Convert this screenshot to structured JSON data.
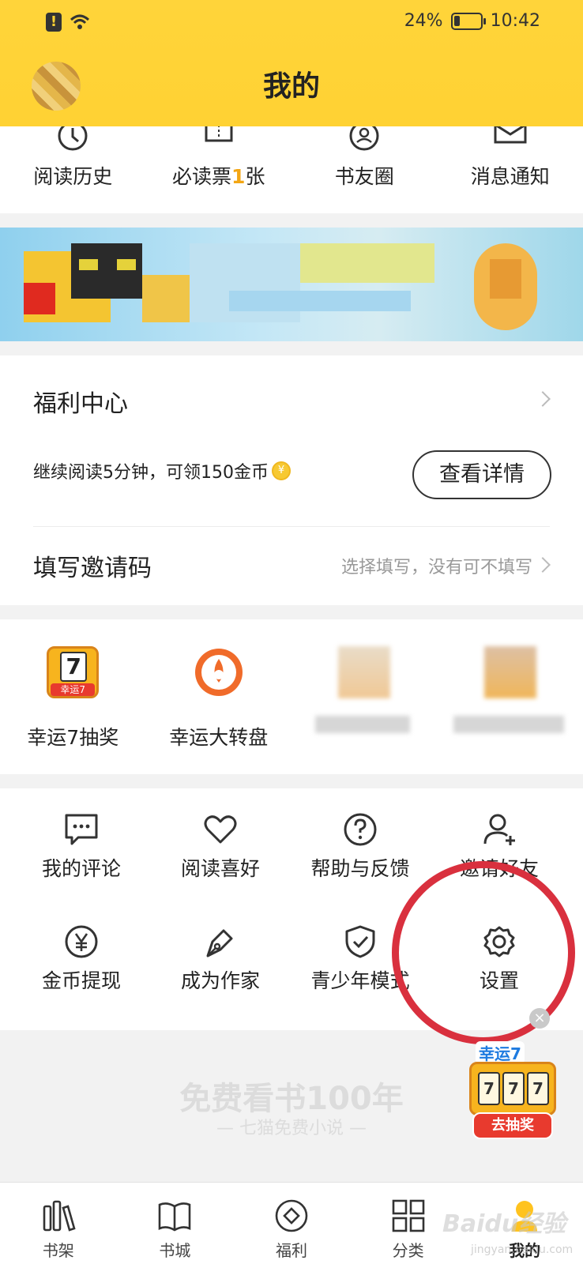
{
  "status_bar": {
    "battery": "24%",
    "battery_level": 0.24,
    "time": "10:42"
  },
  "header": {
    "title": "我的"
  },
  "quick_links": [
    {
      "label": "阅读历史",
      "icon": "clock-icon"
    },
    {
      "label_prefix": "必读票",
      "label_count": "1",
      "label_suffix": "张",
      "icon": "ticket-icon"
    },
    {
      "label": "书友圈",
      "icon": "circle-friends-icon"
    },
    {
      "label": "消息通知",
      "icon": "mail-icon"
    }
  ],
  "welfare": {
    "title": "福利中心",
    "desc": "继续阅读5分钟，可领150金币",
    "coin_symbol": "¥",
    "detail_button": "查看详情",
    "invite_title": "填写邀请码",
    "invite_hint": "选择填写，没有可不填写"
  },
  "games": [
    {
      "label": "幸运7抽奖",
      "badge_digit": "7",
      "badge_text": "幸运7",
      "icon": "lucky7-icon"
    },
    {
      "label": "幸运大转盘",
      "icon": "wheel-icon"
    },
    {
      "label": "",
      "icon": "blurred-icon"
    },
    {
      "label": "",
      "icon": "blurred-icon"
    }
  ],
  "tools": [
    {
      "label": "我的评论",
      "icon": "comment-icon"
    },
    {
      "label": "阅读喜好",
      "icon": "heart-icon"
    },
    {
      "label": "帮助与反馈",
      "icon": "help-icon"
    },
    {
      "label": "邀请好友",
      "icon": "add-user-icon"
    },
    {
      "label": "金币提现",
      "icon": "yen-coin-icon"
    },
    {
      "label": "成为作家",
      "icon": "pen-icon"
    },
    {
      "label": "青少年模式",
      "icon": "shield-check-icon"
    },
    {
      "label": "设置",
      "icon": "gear-icon"
    }
  ],
  "promo": {
    "main": "免费看书100年",
    "sub": "— 七猫免费小说 —",
    "lucky_title": "幸运7",
    "lucky_slots": [
      "7",
      "7",
      "7"
    ],
    "lucky_button": "去抽奖",
    "close_symbol": "×"
  },
  "nav": [
    {
      "label": "书架",
      "icon": "bookshelf-icon"
    },
    {
      "label": "书城",
      "icon": "book-icon"
    },
    {
      "label": "福利",
      "icon": "welfare-icon"
    },
    {
      "label": "分类",
      "icon": "grid-icon"
    },
    {
      "label": "我的",
      "icon": "profile-icon",
      "active": true
    }
  ],
  "watermark": {
    "main": "Baidu经验",
    "sub": "jingyan.baidu.com"
  },
  "colors": {
    "header": "#ffd233",
    "accent": "#f3a614",
    "annotation": "#d9303e"
  }
}
